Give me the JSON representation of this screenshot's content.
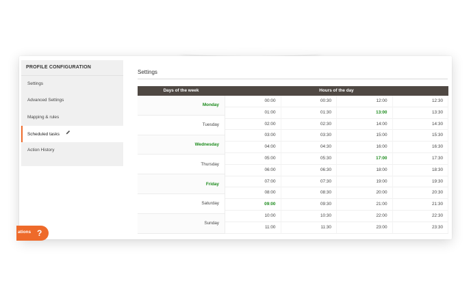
{
  "sidebar": {
    "title": "PROFILE CONFIGURATION",
    "items": [
      {
        "label": "Settings"
      },
      {
        "label": "Advanced Settings"
      },
      {
        "label": "Mapping & rules"
      },
      {
        "label": "Scheduled tasks",
        "active": true
      },
      {
        "label": "Action History"
      }
    ]
  },
  "main": {
    "title": "Settings",
    "schedule": {
      "days_header": "Days of the week",
      "hours_header": "Hours of the day",
      "days": [
        {
          "label": "Monday",
          "selected": true
        },
        {
          "label": "Tuesday",
          "selected": false
        },
        {
          "label": "Wednesday",
          "selected": true
        },
        {
          "label": "Thursday",
          "selected": false
        },
        {
          "label": "Friday",
          "selected": true
        },
        {
          "label": "Saturday",
          "selected": false
        },
        {
          "label": "Sunday",
          "selected": false
        }
      ],
      "hours": [
        [
          "00:00",
          "00:30",
          "12:00",
          "12:30"
        ],
        [
          "01:00",
          "01:30",
          "13:00",
          "13:30"
        ],
        [
          "02:00",
          "02:30",
          "14:00",
          "14:30"
        ],
        [
          "03:00",
          "03:30",
          "15:00",
          "15:30"
        ],
        [
          "04:00",
          "04:30",
          "16:00",
          "16:30"
        ],
        [
          "05:00",
          "05:30",
          "17:00",
          "17:30"
        ],
        [
          "06:00",
          "06:30",
          "18:00",
          "18:30"
        ],
        [
          "07:00",
          "07:30",
          "19:00",
          "19:30"
        ],
        [
          "08:00",
          "08:30",
          "20:00",
          "20:30"
        ],
        [
          "09:00",
          "09:30",
          "21:00",
          "21:30"
        ],
        [
          "10:00",
          "10:30",
          "22:00",
          "22:30"
        ],
        [
          "11:00",
          "11:30",
          "23:00",
          "23:30"
        ]
      ],
      "selected_hours": [
        "13:00",
        "17:00",
        "09:00"
      ]
    }
  },
  "help": {
    "label": "ations",
    "icon": "?"
  },
  "colors": {
    "accent": "#ee6a2a",
    "selected": "#1b8a1b",
    "header_bg": "#4f4843"
  }
}
